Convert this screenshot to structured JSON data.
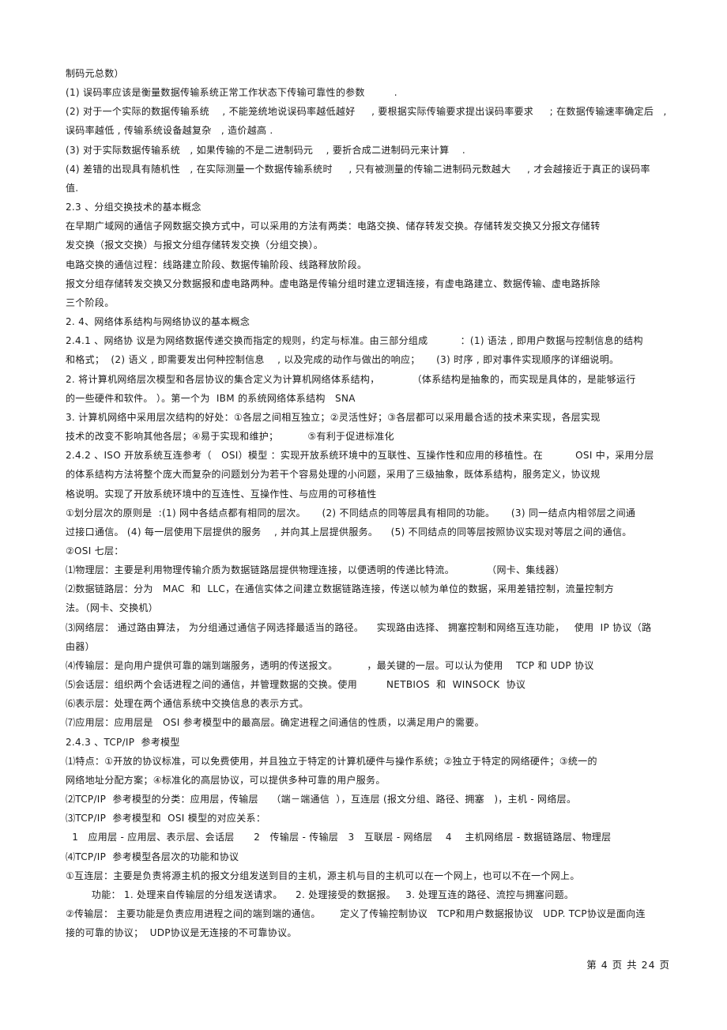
{
  "document": {
    "lines": [
      "制码元总数）",
      "(1) 误码率应该是衡量数据传输系统正常工作状态下传输可靠性的参数         .",
      "(2) 对于一个实际的数据传输系统    , 不能笼统地说误码率越低越好     , 要根据实际传输要求提出误码率要求     ; 在数据传输速率确定后   ,",
      "误码率越低 , 传输系统设备越复杂   , 造价越高 .",
      "(3) 对于实际数据传输系统   , 如果传输的不是二进制码元    , 要折合成二进制码元来计算    .",
      "(4) 差错的出现具有随机性   , 在实际测量一个数据传输系统时     , 只有被测量的传输二进制码元数越大     , 才会越接近于真正的误码率",
      "值.",
      "2.3 、分组交换技术的基本概念",
      "在早期广域网的通信子网数据交换方式中，可以采用的方法有两类：电路交换、储存转发交换。存储转发交换又分报文存储转",
      "发交换（报文交换）与报文分组存储转发交换（分组交换）。",
      "电路交换的通信过程：线路建立阶段、数据传输阶段、线路释放阶段。",
      "报文分组存储转发交换又分数据报和虚电路两种。虚电路是传输分组时建立逻辑连接，有虚电路建立、数据传输、虚电路拆除",
      "三个阶段。",
      "2. 4、网络体系结构与网络协议的基本概念",
      "2.4.1 、网络协 议是为网络数据传递交换而指定的规则，约定与标准。由三部分组成          ：(1) 语法 , 即用户数据与控制信息的结构",
      "和格式；  (2) 语义 , 即需要发出何种控制信息    , 以及完成的动作与做出的响应；     (3) 时序 , 即对事件实现顺序的详细说明。",
      "2. 将计算机网络层次模型和各层协议的集合定义为计算机网络体系结构，          （体系结构是抽象的，而实现是具体的，是能够运行",
      "的一些硬件和软件。 ）。第一个为  IBM 的系统网络体系结构   SNA",
      "3. 计算机网络中采用层次结构的好处：①各层之间相互独立；②灵活性好；③各层都可以采用最合适的技术来实现，各层实现",
      "技术的改变不影响其他各层；④易于实现和维护；         ⑤有利于促进标准化",
      "2.4.2 、ISO 开放系统互连参考（   OSI）模型 ：实现开放系统环境中的互联性、互操作性和应用的移植性。在          OSI 中，采用分层",
      "的体系结构方法将整个庞大而复杂的问题划分为若干个容易处理的小问题，采用了三级抽象，既体系结构，服务定义，协议规",
      "格说明。实现了开放系统环境中的互连性、互操作性、与应用的可移植性",
      "①划分层次的原则是  :(1) 网中各结点都有相同的层次。     (2) 不同结点的同等层具有相同的功能。     (3) 同一结点内相邻层之间通",
      "过接口通信。 (4) 每一层使用下层提供的服务    , 并向其上层提供服务。    (5) 不同结点的同等层按照协议实现对等层之间的通信。",
      "②OSI 七层：",
      "⑴物理层：主要是利用物理传输介质为数据链路层提供物理连接，以便透明的传递比特流。          （网卡、集线器）",
      "⑵数据链路层：分为   MAC  和  LLC，在通信实体之间建立数据链路连接，传送以帧为单位的数据，采用差错控制，流量控制方",
      "法。（网卡、交换机）",
      "⑶网络层： 通过路由算法， 为分组通过通信子网选择最适当的路径。    实现路由选择、 拥塞控制和网络互连功能，   使用  IP 协议（路",
      "由器）",
      "⑷传输层：是向用户提供可靠的端到端服务，透明的传送报文。         ，最关键的一层。可以认为使用    TCP 和 UDP 协议",
      "⑸会话层：组织两个会话进程之间的通信，并管理数据的交换。使用         NETBIOS  和  WINSOCK  协议",
      "⑹表示层：处理在两个通信系统中交换信息的表示方式。",
      "⑺应用层：应用层是   OSI 参考模型中的最高层。确定进程之间通信的性质，以满足用户的需要。",
      "2.4.3 、TCP/IP  参考模型",
      "⑴特点：①开放的协议标准，可以免费使用，并且独立于特定的计算机硬件与操作系统；②独立于特定的网络硬件；③统一的",
      "网络地址分配方案；④标准化的高层协议，可以提供多种可靠的用户服务。",
      "⑵TCP/IP  参考模型的分类：应用层，传输层    （端－端通信  ），互连层 (报文分组、路径、拥塞   )，主机 - 网络层。",
      "⑶TCP/IP  参考模型和  OSI 模型的对应关系：",
      "  1   应用层 - 应用层、表示层、会话层      2   传输层 - 传输层   3   互联层 - 网络层    4    主机网络层 - 数据链路层、物理层",
      "⑷TCP/IP  参考模型各层次的功能和协议",
      "①互连层：主要是负责将源主机的报文分组发送到目的主机，源主机与目的主机可以在一个网上，也可以不在一个网上。",
      "        功能： 1. 处理来自传输层的分组发送请求。    2. 处理接受的数据报。   3. 处理互连的路径、流控与拥塞问题。",
      "②传输层： 主要功能是负责应用进程之间的端到端的通信。      定义了传输控制协议   TCP和用户数据报协议   UDP. TCP协议是面向连",
      "接的可靠的协议；  UDP协议是无连接的不可靠协议。"
    ]
  },
  "footer": {
    "page_indicator": "第 4 页 共 24 页"
  }
}
